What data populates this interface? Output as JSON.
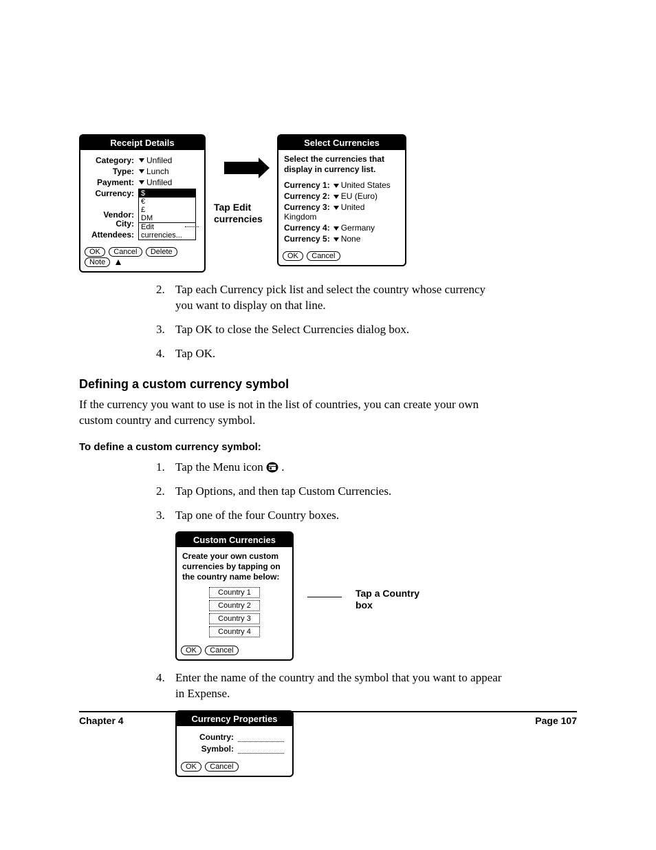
{
  "fig1": {
    "receipt": {
      "title": "Receipt Details",
      "category_label": "Category:",
      "category_value": "Unfiled",
      "type_label": "Type:",
      "type_value": "Lunch",
      "payment_label": "Payment:",
      "payment_value": "Unfiled",
      "currency_label": "Currency:",
      "dropdown": {
        "selected": "$",
        "opt1": "€",
        "opt2": "£",
        "opt3": "DM",
        "opt4": "Edit currencies..."
      },
      "vendor_label": "Vendor:",
      "city_label": "City:",
      "attendees_label": "Attendees:",
      "btn_ok": "OK",
      "btn_cancel": "Cancel",
      "btn_delete": "Delete",
      "btn_note": "Note"
    },
    "callout_mid": "Tap Edit currencies",
    "select": {
      "title": "Select Currencies",
      "instruction": "Select the currencies that display in currency list.",
      "c1_label": "Currency 1:",
      "c1_value": "United States",
      "c2_label": "Currency 2:",
      "c2_value": "EU (Euro)",
      "c3_label": "Currency 3:",
      "c3_value": "United Kingdom",
      "c4_label": "Currency 4:",
      "c4_value": "Germany",
      "c5_label": "Currency 5:",
      "c5_value": "None",
      "btn_ok": "OK",
      "btn_cancel": "Cancel"
    }
  },
  "steps_a": {
    "n2": "2.",
    "t2": "Tap each Currency pick list and select the country whose currency you want to display on that line.",
    "n3": "3.",
    "t3": "Tap OK to close the Select Currencies dialog box.",
    "n4": "4.",
    "t4": "Tap OK."
  },
  "heading1": "Defining a custom currency symbol",
  "para1": "If the currency you want to use is not in the list of countries, you can create your own custom country and currency symbol.",
  "heading2": "To define a custom currency symbol:",
  "steps_b": {
    "n1": "1.",
    "t1a": "Tap the Menu icon ",
    "t1b": ".",
    "n2": "2.",
    "t2": "Tap Options, and then tap Custom Currencies.",
    "n3": "3.",
    "t3": "Tap one of the four Country boxes."
  },
  "fig2": {
    "title": "Custom Currencies",
    "instruction": "Create your own custom currencies by tapping on the country name below:",
    "country1": "Country 1",
    "country2": "Country 2",
    "country3": "Country 3",
    "country4": "Country 4",
    "btn_ok": "OK",
    "btn_cancel": "Cancel",
    "callout": "Tap a Country box"
  },
  "steps_c": {
    "n4": "4.",
    "t4": "Enter the name of the country and the symbol that you want to appear in Expense."
  },
  "fig3": {
    "title": "Currency Properties",
    "country_label": "Country:",
    "symbol_label": "Symbol:",
    "btn_ok": "OK",
    "btn_cancel": "Cancel"
  },
  "footer": {
    "chapter": "Chapter 4",
    "page": "Page 107"
  }
}
